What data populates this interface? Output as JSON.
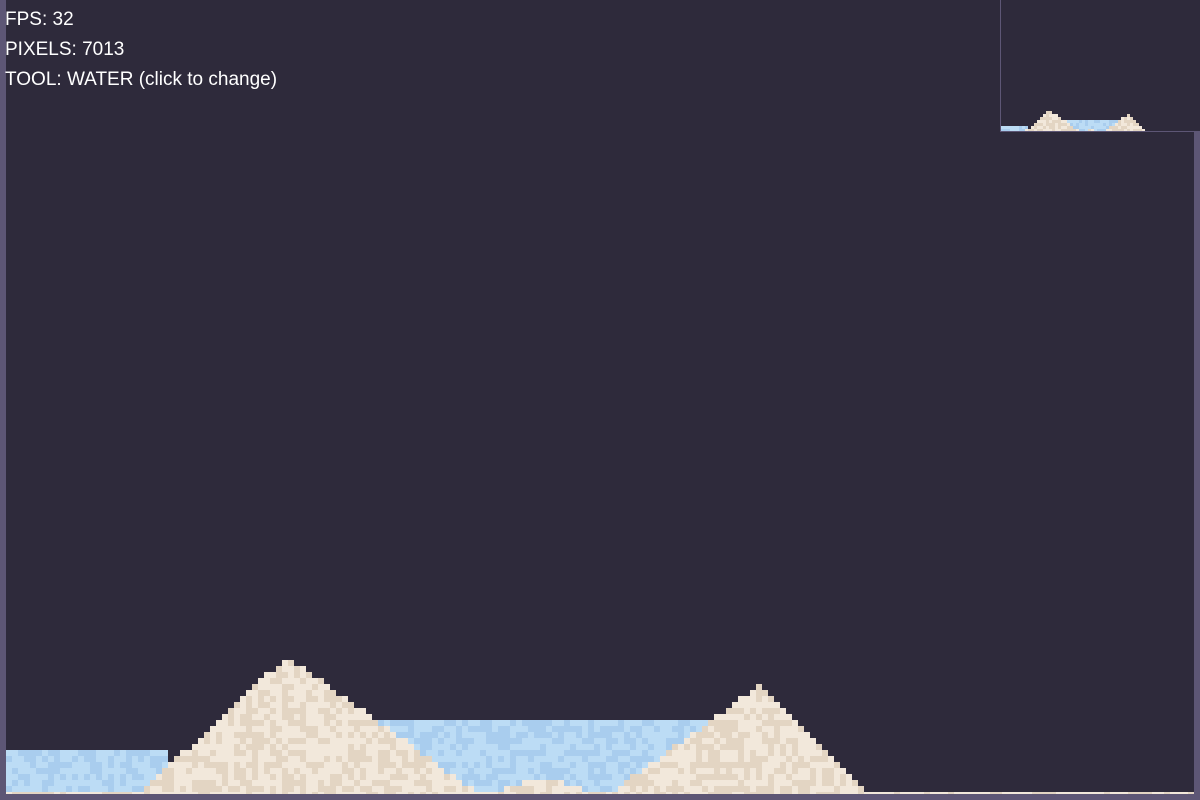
{
  "hud": {
    "fps_label": "FPS:",
    "fps_value": "32",
    "pixels_label": "PIXELS:",
    "pixels_value": "7013",
    "tool_label": "TOOL:",
    "tool_value": "WATER",
    "tool_hint": "(click to change)"
  },
  "colors": {
    "background": "#2e2a3b",
    "frame": "#5d5675",
    "sand_light": "#f2e8db",
    "sand_dark": "#e3d5c3",
    "water_light": "#bcdcf5",
    "water_dark": "#a9cdee",
    "text": "#ffffff"
  },
  "materials": [
    "sand",
    "water"
  ]
}
